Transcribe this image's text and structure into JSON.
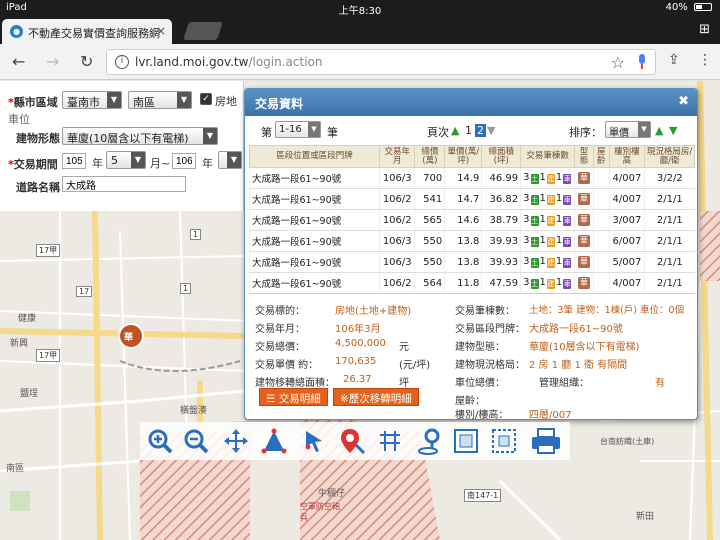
{
  "status_bar": {
    "device": "iPad",
    "time": "上午8:30",
    "battery": "40%",
    "battery_level": 0.4
  },
  "browser": {
    "tab_title": "不動產交易實價查詢服務網",
    "url_host": "lvr.land.moi.gov.tw",
    "url_path": "/login.action"
  },
  "query": {
    "county_label": "縣市區域",
    "county_value": "臺南市",
    "district_value": "南區",
    "house_label": "房地",
    "unit_label": "車位",
    "building_type_label": "建物形態",
    "building_type_value": "華廈(10層含以下有電梯)",
    "period_label": "交易期間",
    "from_year": "105",
    "year_unit": "年",
    "from_month": "5",
    "month_to": "月~",
    "to_year": "106",
    "year_unit2": "年",
    "road_label": "道路名稱",
    "road_value": "大成路"
  },
  "dialog": {
    "title": "交易資料",
    "page_prefix": "第",
    "page_select": "1-16",
    "page_suffix": "筆",
    "page_label": "頁次",
    "page_1": "1",
    "page_2": "2",
    "sort_label": "排序：",
    "sort_value": "單價",
    "headers": [
      "區段位置或區段門牌",
      "交易年月",
      "總價(萬)",
      "單價(萬/坪)",
      "總面積(坪)",
      "交易筆棟數",
      "型態",
      "屋齡",
      "樓別樓高",
      "現況格局房/廳/衛"
    ],
    "rows": [
      {
        "addr": "大成路一段61~90號",
        "ym": "106/3",
        "total": "700",
        "unit": "14.9",
        "area": "46.99",
        "c1": "3",
        "c2": "1",
        "c3": "1",
        "type": "華",
        "age": "",
        "floor": "4/007",
        "layout": "3/2/2"
      },
      {
        "addr": "大成路一段61~90號",
        "ym": "106/2",
        "total": "541",
        "unit": "14.7",
        "area": "36.82",
        "c1": "3",
        "c2": "1",
        "c3": "1",
        "type": "華",
        "age": "",
        "floor": "4/007",
        "layout": "2/1/1"
      },
      {
        "addr": "大成路一段61~90號",
        "ym": "106/2",
        "total": "565",
        "unit": "14.6",
        "area": "38.79",
        "c1": "3",
        "c2": "1",
        "c3": "1",
        "type": "華",
        "age": "",
        "floor": "3/007",
        "layout": "2/1/1"
      },
      {
        "addr": "大成路一段61~90號",
        "ym": "106/3",
        "total": "550",
        "unit": "13.8",
        "area": "39.93",
        "c1": "3",
        "c2": "1",
        "c3": "1",
        "type": "華",
        "age": "",
        "floor": "6/007",
        "layout": "2/1/1"
      },
      {
        "addr": "大成路一段61~90號",
        "ym": "106/3",
        "total": "550",
        "unit": "13.8",
        "area": "39.93",
        "c1": "3",
        "c2": "1",
        "c3": "1",
        "type": "華",
        "age": "",
        "floor": "5/007",
        "layout": "2/1/1"
      },
      {
        "addr": "大成路一段61~90號",
        "ym": "106/2",
        "total": "564",
        "unit": "11.8",
        "area": "47.59",
        "c1": "3",
        "c2": "1",
        "c3": "1",
        "type": "華",
        "age": "",
        "floor": "4/007",
        "layout": "2/1/1"
      }
    ],
    "chip_labels": {
      "land": "土",
      "building": "建",
      "parking": "車"
    },
    "detail": {
      "target_label": "交易標的：",
      "target_value": "房地(土地+建物)",
      "ym_label": "交易年月：",
      "ym_value": "106年3月",
      "total_label": "交易總價：",
      "total_value": "4,500,000",
      "total_unit": "元",
      "unit_label": "交易單價 約：",
      "unit_value": "170,635",
      "unit_unit": "(元/坪)",
      "area_label": "建物移轉總面積：",
      "area_value": "26.37",
      "area_unit": "坪",
      "count_label": "交易筆棟數：",
      "count_value": "土地：3筆 建物：1棟(戶) 車位：0個",
      "addr_label": "交易區段門牌：",
      "addr_value": "大成路一段61~90號",
      "btype_label": "建物型態：",
      "btype_value": "華廈(10層含以下有電梯)",
      "layout_label": "建物現況格局：",
      "layout_value": "2 房 1 廳 1 衛 有隔間",
      "parking_label": "車位總價：",
      "mgmt_label": "管理組織：",
      "mgmt_value": "有",
      "age_label": "屋齡：",
      "floor_label": "樓別/樓高：",
      "floor_value": "四層/007",
      "btn_detail": "交易明細",
      "btn_history": "※歷次移轉明細"
    }
  },
  "map": {
    "labels": {
      "road_17": "17",
      "road_17a": "17甲",
      "road_1": "1",
      "marker": "華",
      "place_1": "健康",
      "place_2": "鹽埕",
      "place_3": "新興",
      "place_4": "台南紡織(土庫)",
      "place_5": "牛稠仔",
      "place_6": "空軍防空砲兵",
      "place_7": "新田",
      "road_147": "南147-1",
      "place_8": "橫盤湊",
      "place_9": "南區"
    }
  },
  "colors": {
    "accent": "#3a72a8",
    "highlight": "#c0601a",
    "button": "#e8611a"
  }
}
